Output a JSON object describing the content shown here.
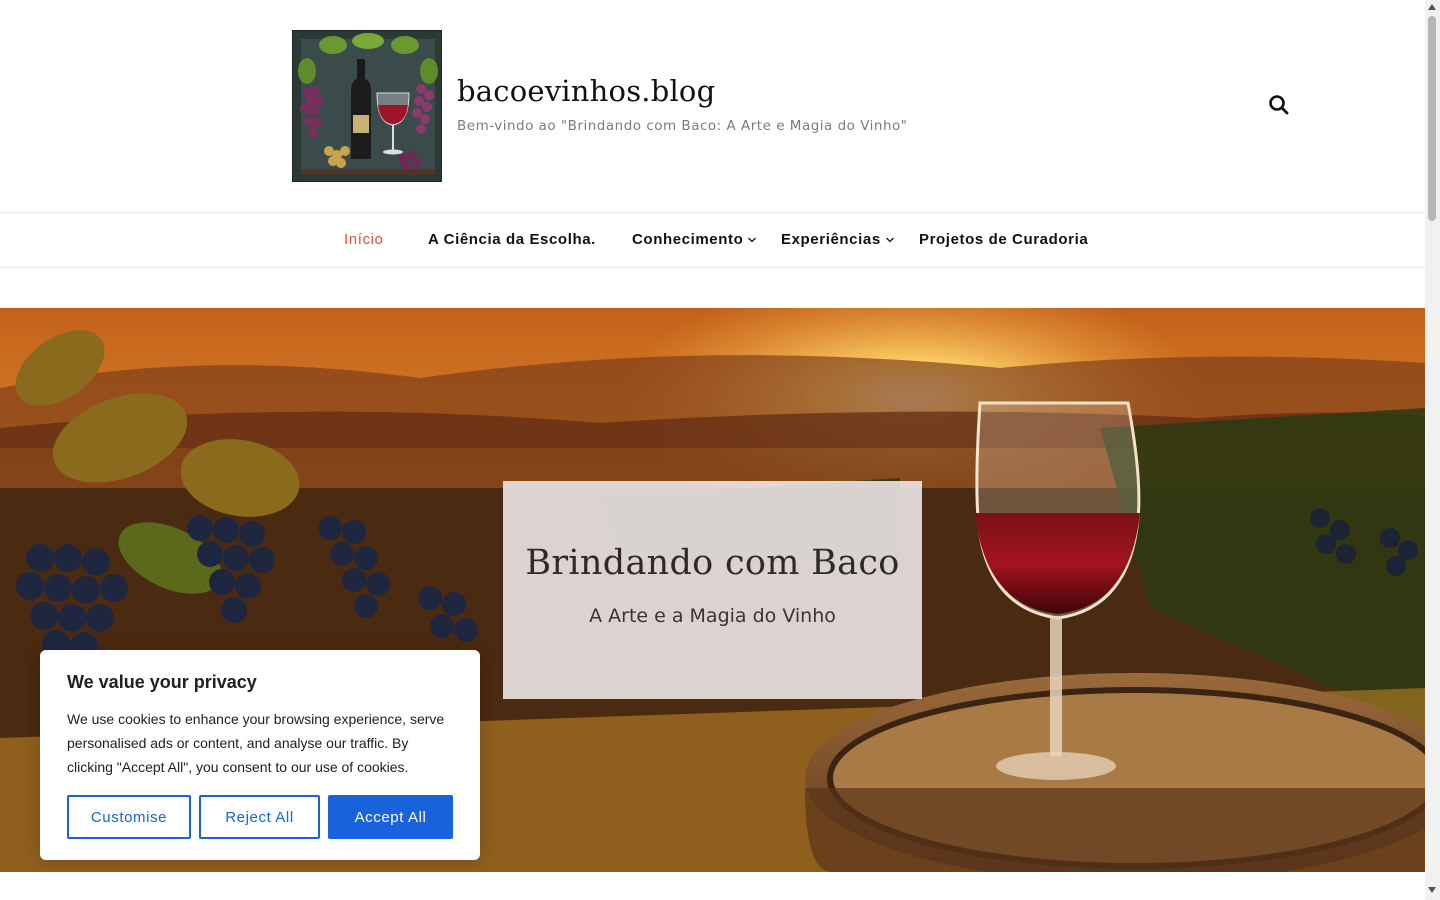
{
  "header": {
    "site_title": "bacoevinhos.blog",
    "tagline": "Bem-vindo ao \"Brindando com Baco: A Arte e Magia do Vinho\"",
    "logo_icon": "wine-bottle-grapes-logo",
    "search_icon": "search-icon"
  },
  "nav": {
    "items": [
      {
        "label": "Início",
        "active": true,
        "has_submenu": false
      },
      {
        "label": "A Ciência da Escolha.",
        "active": false,
        "has_submenu": false
      },
      {
        "label": "Conhecimento",
        "active": false,
        "has_submenu": true
      },
      {
        "label": "Experiências",
        "active": false,
        "has_submenu": true
      },
      {
        "label": "Projetos de Curadoria",
        "active": false,
        "has_submenu": false
      }
    ],
    "active_color": "#e0533d"
  },
  "hero": {
    "title": "Brindando com Baco",
    "subtitle": "A Arte e a Magia do Vinho"
  },
  "cookie_banner": {
    "title": "We value your privacy",
    "text": "We use cookies to enhance your browsing experience, serve personalised ads or content, and analyse our traffic. By clicking \"Accept All\", you consent to our use of cookies.",
    "customise_label": "Customise",
    "reject_label": "Reject All",
    "accept_label": "Accept All",
    "accent_color": "#1863dc"
  }
}
